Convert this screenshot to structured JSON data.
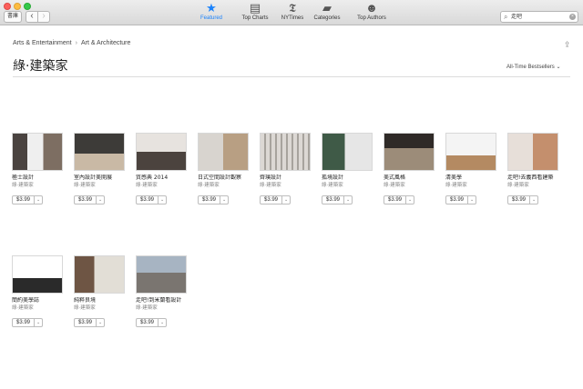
{
  "toolbar": {
    "library_label": "書庫",
    "back_glyph": "‹",
    "forward_glyph": "›",
    "tabs": [
      {
        "label": "Featured",
        "glyph": "★"
      },
      {
        "label": "Top Charts",
        "glyph": "▤"
      },
      {
        "label": "NYTimes",
        "glyph": "𝕿"
      },
      {
        "label": "Categories",
        "glyph": "▰"
      },
      {
        "label": "Top Authors",
        "glyph": "☻"
      }
    ],
    "search_value": "走吧",
    "clear_glyph": "×"
  },
  "breadcrumb": {
    "level1": "Arts & Entertainment",
    "separator": "›",
    "level2": "Art & Architecture"
  },
  "page_title": "綠·建築家",
  "sort_label": "All-Time Bestsellers ⌄",
  "books": [
    {
      "title": "極士設計",
      "author": "綠·建築家",
      "price": "$3.99"
    },
    {
      "title": "室內設計美開展",
      "author": "綠·建築家",
      "price": "$3.99"
    },
    {
      "title": "質感典 2014",
      "author": "綠·建築家",
      "price": "$3.99"
    },
    {
      "title": "日式空間設計觀察",
      "author": "綠·建築家",
      "price": "$3.99"
    },
    {
      "title": "齊璞設計",
      "author": "綠·建築家",
      "price": "$3.99"
    },
    {
      "title": "孤境設計",
      "author": "綠·建築家",
      "price": "$3.99"
    },
    {
      "title": "美式風格",
      "author": "綠·建築家",
      "price": "$3.99"
    },
    {
      "title": "清美學",
      "author": "綠·建築家",
      "price": "$3.99"
    },
    {
      "title": "走吧!去義西看建築",
      "author": "綠·建築家",
      "price": "$3.99"
    },
    {
      "title": "簡約美學誌",
      "author": "綠·建築家",
      "price": "$3.99"
    },
    {
      "title": "純粹良境",
      "author": "綠·建築家",
      "price": "$3.99"
    },
    {
      "title": "走吧!到米蘭看設計",
      "author": "綠·建築家",
      "price": "$3.99"
    }
  ],
  "price_chevron": "⌄",
  "colors": {
    "accent": "#1a82fb",
    "toolbar_bg": "#e3e3e3"
  }
}
